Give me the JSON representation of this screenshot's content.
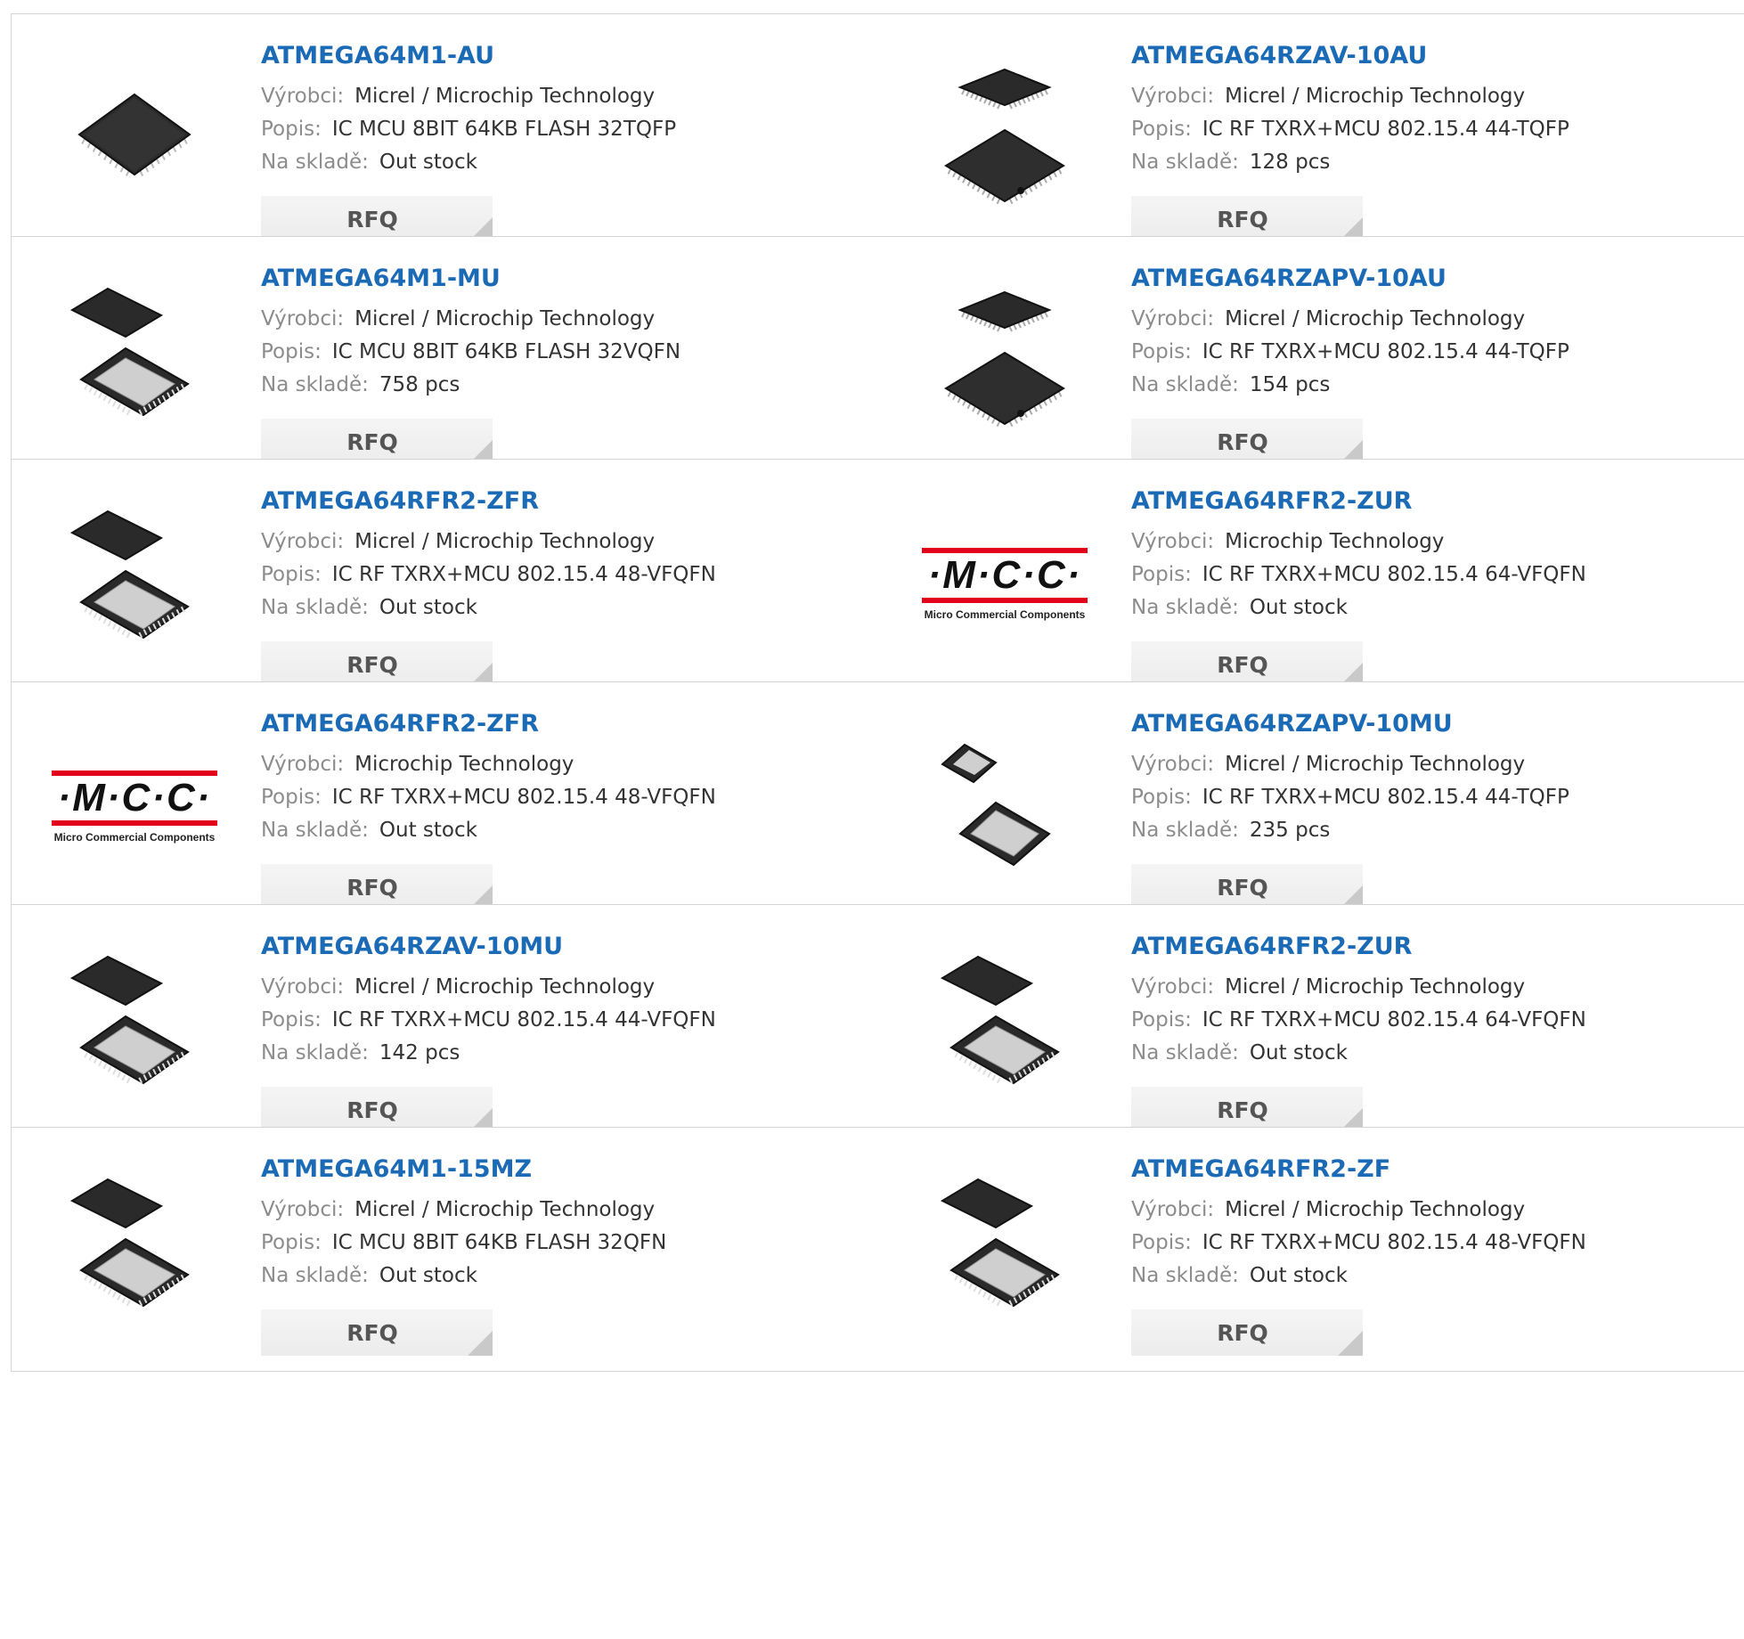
{
  "labels": {
    "manufacturer": "Výrobci:",
    "description": "Popis:",
    "stock": "Na skladě:",
    "rfq": "RFQ"
  },
  "logo": {
    "mcc_text": "·M·C·C·",
    "mcc_subtitle": "Micro Commercial Components"
  },
  "products": [
    {
      "part": "ATMEGA64M1-AU",
      "manufacturer": "Micrel / Microchip Technology",
      "description": "IC MCU 8BIT 64KB FLASH 32TQFP",
      "stock": "Out stock",
      "image": "tqfp-chip-icon"
    },
    {
      "part": "ATMEGA64RZAV-10AU",
      "manufacturer": "Micrel / Microchip Technology",
      "description": "IC RF TXRX+MCU 802.15.4 44-TQFP",
      "stock": "128 pcs",
      "image": "tqfp-pair-icon"
    },
    {
      "part": "ATMEGA64M1-MU",
      "manufacturer": "Micrel / Microchip Technology",
      "description": "IC MCU 8BIT 64KB FLASH 32VQFN",
      "stock": "758 pcs",
      "image": "qfn-pair-icon"
    },
    {
      "part": "ATMEGA64RZAPV-10AU",
      "manufacturer": "Micrel / Microchip Technology",
      "description": "IC RF TXRX+MCU 802.15.4 44-TQFP",
      "stock": "154 pcs",
      "image": "tqfp-pair-icon"
    },
    {
      "part": "ATMEGA64RFR2-ZFR",
      "manufacturer": "Micrel / Microchip Technology",
      "description": "IC RF TXRX+MCU 802.15.4 48-VFQFN",
      "stock": "Out stock",
      "image": "qfn-pair-icon"
    },
    {
      "part": "ATMEGA64RFR2-ZUR",
      "manufacturer": "Microchip Technology",
      "description": "IC RF TXRX+MCU 802.15.4 64-VFQFN",
      "stock": "Out stock",
      "image": "mcc-logo"
    },
    {
      "part": "ATMEGA64RFR2-ZFR",
      "manufacturer": "Microchip Technology",
      "description": "IC RF TXRX+MCU 802.15.4 48-VFQFN",
      "stock": "Out stock",
      "image": "mcc-logo"
    },
    {
      "part": "ATMEGA64RZAPV-10MU",
      "manufacturer": "Micrel / Microchip Technology",
      "description": "IC RF TXRX+MCU 802.15.4 44-TQFP",
      "stock": "235 pcs",
      "image": "qfn-small-pair-icon"
    },
    {
      "part": "ATMEGA64RZAV-10MU",
      "manufacturer": "Micrel / Microchip Technology",
      "description": "IC RF TXRX+MCU 802.15.4 44-VFQFN",
      "stock": "142 pcs",
      "image": "qfn-pair-icon"
    },
    {
      "part": "ATMEGA64RFR2-ZUR",
      "manufacturer": "Micrel / Microchip Technology",
      "description": "IC RF TXRX+MCU 802.15.4 64-VFQFN",
      "stock": "Out stock",
      "image": "qfn-pair-icon"
    },
    {
      "part": "ATMEGA64M1-15MZ",
      "manufacturer": "Micrel / Microchip Technology",
      "description": "IC MCU 8BIT 64KB FLASH 32QFN",
      "stock": "Out stock",
      "image": "qfn-pair-icon"
    },
    {
      "part": "ATMEGA64RFR2-ZF",
      "manufacturer": "Micrel / Microchip Technology",
      "description": "IC RF TXRX+MCU 802.15.4 48-VFQFN",
      "stock": "Out stock",
      "image": "qfn-pair-icon"
    }
  ]
}
